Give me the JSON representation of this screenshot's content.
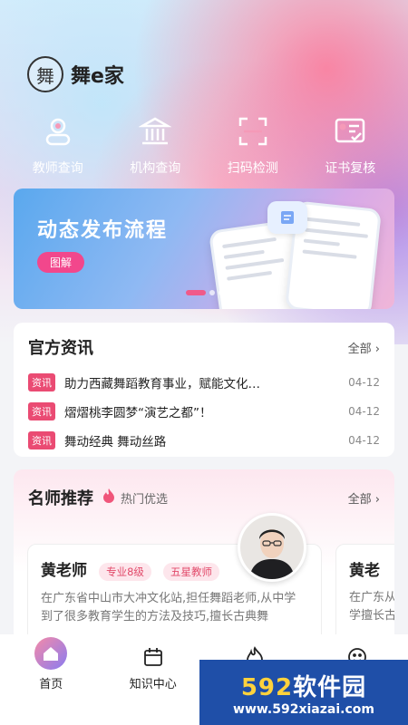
{
  "app": {
    "name": "舞e家",
    "logo_glyph": "舞"
  },
  "quick_links": [
    {
      "label": "教师查询",
      "icon": "person-icon"
    },
    {
      "label": "机构查询",
      "icon": "institution-icon"
    },
    {
      "label": "扫码检测",
      "icon": "scan-icon"
    },
    {
      "label": "证书复核",
      "icon": "certificate-icon"
    }
  ],
  "banner": {
    "title": "动态发布流程",
    "button": "图解"
  },
  "news": {
    "title": "官方资讯",
    "more": "全部 ›",
    "items": [
      {
        "tag": "资讯",
        "text": "助力西藏舞蹈教育事业，赋能文化…",
        "date": "04-12"
      },
      {
        "tag": "资讯",
        "text": "熠熠桃李圆梦“演艺之都”！",
        "date": "04-12"
      },
      {
        "tag": "资讯",
        "text": "舞动经典 舞动丝路",
        "date": "04-12"
      }
    ]
  },
  "teachers": {
    "title": "名师推荐",
    "subtitle": "热门优选",
    "more": "全部 ›",
    "cards": [
      {
        "name": "黄老师",
        "badges": [
          "专业8级",
          "五星教师"
        ],
        "desc": "在广东省中山市大冲文化站,担任舞蹈老师,从中学到了很多教育学生的方法及技巧,擅长古典舞"
      },
      {
        "name": "黄老",
        "desc": "在广东从中学擅长古"
      }
    ]
  },
  "tabbar": [
    {
      "label": "首页",
      "icon": "home-icon"
    },
    {
      "label": "知识中心",
      "icon": "calendar-icon"
    },
    {
      "label": "",
      "icon": "flame-icon"
    },
    {
      "label": "",
      "icon": "smile-icon"
    }
  ],
  "watermark": {
    "main_num": "592",
    "main_text": "软件园",
    "url": "www.592xiazai.com"
  },
  "colors": {
    "accent": "#ea4b73",
    "banner_button": "#f2478c",
    "watermark_bg": "#1f4fa8"
  }
}
